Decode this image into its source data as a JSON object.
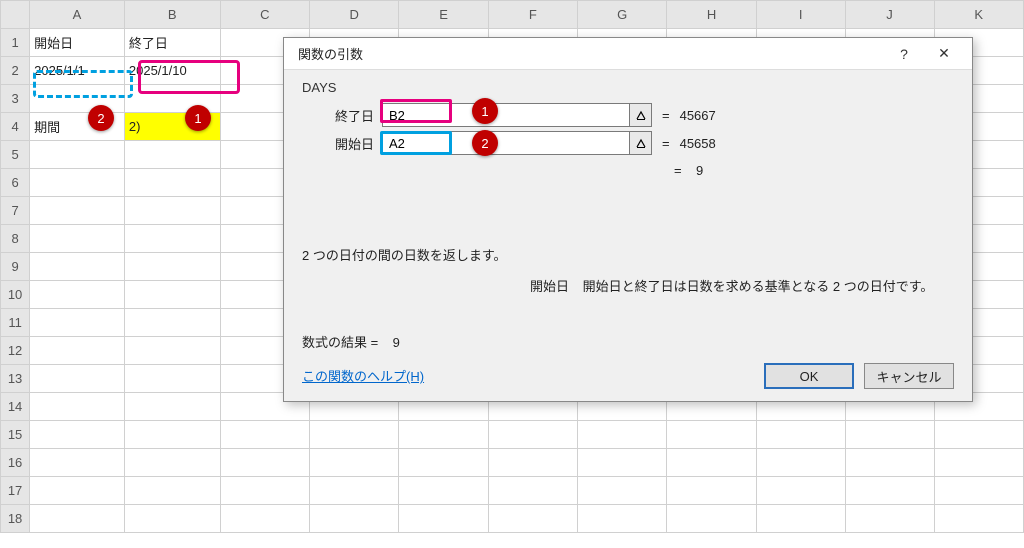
{
  "sheet": {
    "columns": [
      "A",
      "B",
      "C",
      "D",
      "E",
      "F",
      "G",
      "H",
      "I",
      "J",
      "K"
    ],
    "rows": 18,
    "cells": {
      "A1": "開始日",
      "B1": "終了日",
      "A2": "2025/1/1",
      "B2": "2025/1/10",
      "A4": "期間",
      "B4": "2)"
    }
  },
  "badges": {
    "one": "1",
    "two": "2"
  },
  "dialog": {
    "title": "関数の引数",
    "help_q": "?",
    "close_x": "✕",
    "function_name": "DAYS",
    "args": {
      "end": {
        "label": "終了日",
        "value": "B2",
        "result": "45667"
      },
      "start": {
        "label": "開始日",
        "value": "A2",
        "result": "45658"
      }
    },
    "equals": "=",
    "total_result": "9",
    "description": "2 つの日付の間の日数を返します。",
    "arg_help": {
      "name": "開始日",
      "text": "開始日と終了日は日数を求める基準となる 2 つの日付です。"
    },
    "formula_result_label": "数式の結果 =",
    "formula_result_value": "9",
    "help_link": "この関数のヘルプ(H)",
    "ok": "OK",
    "cancel": "キャンセル"
  }
}
